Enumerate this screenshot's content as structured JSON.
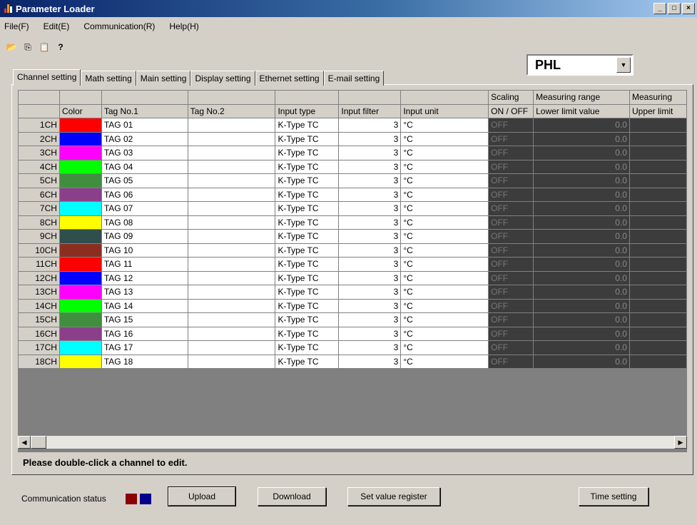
{
  "window": {
    "title": "Parameter Loader",
    "controls": [
      "_",
      "□",
      "×"
    ]
  },
  "menu": [
    "File(F)",
    "Edit(E)",
    "Communication(R)",
    "Help(H)"
  ],
  "toolbar": [
    {
      "name": "open-icon",
      "glyph": "📂"
    },
    {
      "name": "copy-icon",
      "glyph": "⎘"
    },
    {
      "name": "paste-icon",
      "glyph": "📋"
    },
    {
      "name": "help-icon",
      "glyph": "?"
    }
  ],
  "model_select": {
    "value": "PHL"
  },
  "tabs": [
    "Channel setting",
    "Math setting",
    "Main setting",
    "Display setting",
    "Ethernet setting",
    "E-mail setting"
  ],
  "active_tab": 0,
  "grid": {
    "header_row1": [
      "",
      "",
      "",
      "",
      "",
      "",
      "",
      "Scaling",
      "Measuring range",
      "Measuring"
    ],
    "header_row2": [
      "",
      "Color",
      "Tag No.1",
      "Tag No.2",
      "Input type",
      "Input filter",
      "Input unit",
      "ON / OFF",
      "Lower limit value",
      "Upper limit"
    ],
    "rows": [
      {
        "ch": "1CH",
        "color": "#ff0000",
        "tag1": "TAG 01",
        "tag2": "",
        "type": "K-Type TC",
        "filter": "3",
        "unit": "°C",
        "scaling": "OFF",
        "lower": "0.0"
      },
      {
        "ch": "2CH",
        "color": "#0000ff",
        "tag1": "TAG 02",
        "tag2": "",
        "type": "K-Type TC",
        "filter": "3",
        "unit": "°C",
        "scaling": "OFF",
        "lower": "0.0"
      },
      {
        "ch": "3CH",
        "color": "#ff00ff",
        "tag1": "TAG 03",
        "tag2": "",
        "type": "K-Type TC",
        "filter": "3",
        "unit": "°C",
        "scaling": "OFF",
        "lower": "0.0"
      },
      {
        "ch": "4CH",
        "color": "#00ff00",
        "tag1": "TAG 04",
        "tag2": "",
        "type": "K-Type TC",
        "filter": "3",
        "unit": "°C",
        "scaling": "OFF",
        "lower": "0.0"
      },
      {
        "ch": "5CH",
        "color": "#3f8f3f",
        "tag1": "TAG 05",
        "tag2": "",
        "type": "K-Type TC",
        "filter": "3",
        "unit": "°C",
        "scaling": "OFF",
        "lower": "0.0"
      },
      {
        "ch": "6CH",
        "color": "#8b3f8b",
        "tag1": "TAG 06",
        "tag2": "",
        "type": "K-Type TC",
        "filter": "3",
        "unit": "°C",
        "scaling": "OFF",
        "lower": "0.0"
      },
      {
        "ch": "7CH",
        "color": "#00ffff",
        "tag1": "TAG 07",
        "tag2": "",
        "type": "K-Type TC",
        "filter": "3",
        "unit": "°C",
        "scaling": "OFF",
        "lower": "0.0"
      },
      {
        "ch": "8CH",
        "color": "#ffff00",
        "tag1": "TAG 08",
        "tag2": "",
        "type": "K-Type TC",
        "filter": "3",
        "unit": "°C",
        "scaling": "OFF",
        "lower": "0.0"
      },
      {
        "ch": "9CH",
        "color": "#2f4f4f",
        "tag1": "TAG 09",
        "tag2": "",
        "type": "K-Type TC",
        "filter": "3",
        "unit": "°C",
        "scaling": "OFF",
        "lower": "0.0"
      },
      {
        "ch": "10CH",
        "color": "#8b2e1f",
        "tag1": "TAG 10",
        "tag2": "",
        "type": "K-Type TC",
        "filter": "3",
        "unit": "°C",
        "scaling": "OFF",
        "lower": "0.0"
      },
      {
        "ch": "11CH",
        "color": "#ff0000",
        "tag1": "TAG 11",
        "tag2": "",
        "type": "K-Type TC",
        "filter": "3",
        "unit": "°C",
        "scaling": "OFF",
        "lower": "0.0"
      },
      {
        "ch": "12CH",
        "color": "#0000ff",
        "tag1": "TAG 12",
        "tag2": "",
        "type": "K-Type TC",
        "filter": "3",
        "unit": "°C",
        "scaling": "OFF",
        "lower": "0.0"
      },
      {
        "ch": "13CH",
        "color": "#ff00ff",
        "tag1": "TAG 13",
        "tag2": "",
        "type": "K-Type TC",
        "filter": "3",
        "unit": "°C",
        "scaling": "OFF",
        "lower": "0.0"
      },
      {
        "ch": "14CH",
        "color": "#00ff00",
        "tag1": "TAG 14",
        "tag2": "",
        "type": "K-Type TC",
        "filter": "3",
        "unit": "°C",
        "scaling": "OFF",
        "lower": "0.0"
      },
      {
        "ch": "15CH",
        "color": "#3f8f3f",
        "tag1": "TAG 15",
        "tag2": "",
        "type": "K-Type TC",
        "filter": "3",
        "unit": "°C",
        "scaling": "OFF",
        "lower": "0.0"
      },
      {
        "ch": "16CH",
        "color": "#8b3f8b",
        "tag1": "TAG 16",
        "tag2": "",
        "type": "K-Type TC",
        "filter": "3",
        "unit": "°C",
        "scaling": "OFF",
        "lower": "0.0"
      },
      {
        "ch": "17CH",
        "color": "#00ffff",
        "tag1": "TAG 17",
        "tag2": "",
        "type": "K-Type TC",
        "filter": "3",
        "unit": "°C",
        "scaling": "OFF",
        "lower": "0.0"
      },
      {
        "ch": "18CH",
        "color": "#ffff00",
        "tag1": "TAG 18",
        "tag2": "",
        "type": "K-Type TC",
        "filter": "3",
        "unit": "°C",
        "scaling": "OFF",
        "lower": "0.0"
      }
    ]
  },
  "hint": "Please double-click a channel to edit.",
  "status": {
    "label": "Communication status",
    "leds": [
      "#8b0000",
      "#00008b"
    ]
  },
  "buttons": {
    "upload": "Upload",
    "download": "Download",
    "set_value_register": "Set value register",
    "time_setting": "Time setting"
  }
}
